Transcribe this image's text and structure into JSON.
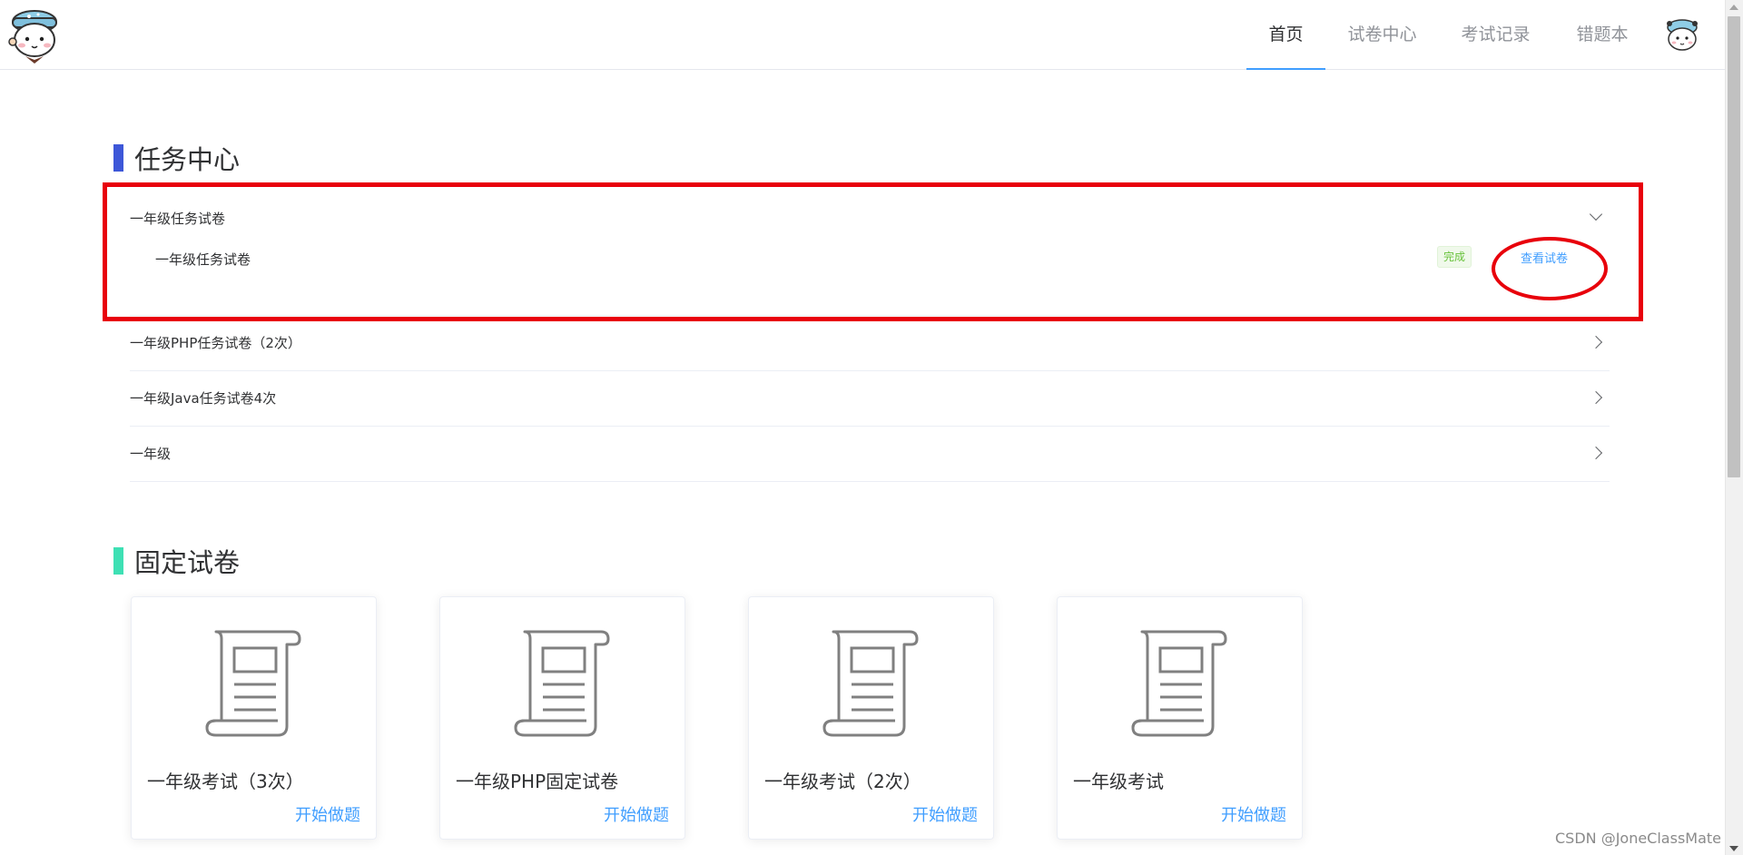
{
  "nav": {
    "items": [
      {
        "label": "首页",
        "active": true
      },
      {
        "label": "试卷中心",
        "active": false
      },
      {
        "label": "考试记录",
        "active": false
      },
      {
        "label": "错题本",
        "active": false
      }
    ]
  },
  "icons": {
    "logo": "cartoon-character-logo",
    "avatar": "cartoon-character-avatar",
    "paper": "scroll-document-icon"
  },
  "colors": {
    "accent": "#409eff",
    "task_bar": "#3d57d8",
    "fixed_bar": "#3ee0b4",
    "highlight": "#e8000b",
    "success": "#67c23a"
  },
  "task_center": {
    "title": "任务中心",
    "items": [
      {
        "label": "一年级任务试卷",
        "expanded": true,
        "sub": {
          "label": "一年级任务试卷",
          "status": "完成",
          "action": "查看试卷"
        }
      },
      {
        "label": "一年级PHP任务试卷（2次）",
        "expanded": false
      },
      {
        "label": "一年级Java任务试卷4次",
        "expanded": false
      },
      {
        "label": "一年级",
        "expanded": false
      }
    ]
  },
  "fixed_papers": {
    "title": "固定试卷",
    "cards": [
      {
        "title": "一年级考试（3次）",
        "action": "开始做题"
      },
      {
        "title": "一年级PHP固定试卷",
        "action": "开始做题"
      },
      {
        "title": "一年级考试（2次）",
        "action": "开始做题"
      },
      {
        "title": "一年级考试",
        "action": "开始做题"
      }
    ]
  },
  "watermark": "CSDN @JoneClassMate"
}
